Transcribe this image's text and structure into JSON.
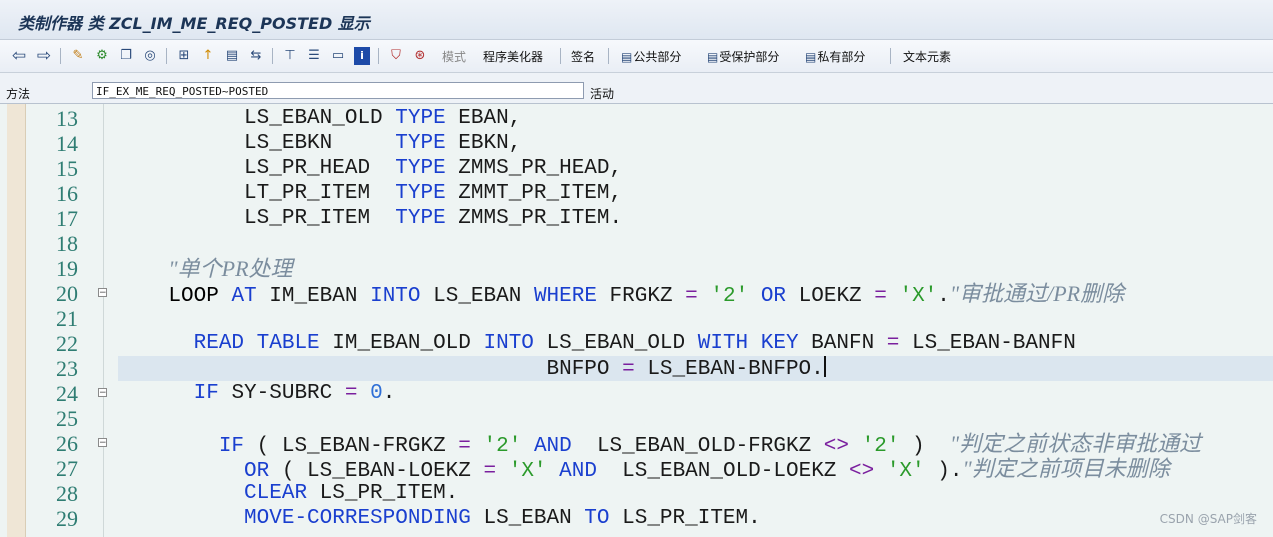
{
  "window": {
    "title": "类制作器 类 ZCL_IM_ME_REQ_POSTED 显示"
  },
  "toolbar": {
    "icons": [
      "back-arrow-icon",
      "forward-arrow-icon",
      "edit-pencil-icon",
      "display-change-icon",
      "object-list-icon",
      "where-used-icon",
      "hierarchy-icon",
      "breakpoint-icon",
      "properties-icon",
      "navigate-icon",
      "tree-icon",
      "stack-icon",
      "window-icon",
      "info-icon",
      "pattern-icon",
      "check-icon"
    ],
    "mode": "模式",
    "pretty_printer": "程序美化器",
    "signature": "签名",
    "public_section": "公共部分",
    "protected_section": "受保护部分",
    "private_section": "私有部分",
    "text_elements": "文本元素"
  },
  "method": {
    "label": "方法",
    "value": "IF_EX_ME_REQ_POSTED~POSTED",
    "status": "活动"
  },
  "editor": {
    "lines": [
      {
        "n": "13",
        "fold": false,
        "indent": "          ",
        "parts": [
          [
            "id",
            "LS_EBAN_OLD "
          ],
          [
            "kw",
            "TYPE"
          ],
          [
            "id",
            " EBAN,"
          ]
        ]
      },
      {
        "n": "14",
        "fold": false,
        "indent": "          ",
        "parts": [
          [
            "id",
            "LS_EBKN     "
          ],
          [
            "kw",
            "TYPE"
          ],
          [
            "id",
            " EBKN,"
          ]
        ]
      },
      {
        "n": "15",
        "fold": false,
        "indent": "          ",
        "parts": [
          [
            "id",
            "LS_PR_HEAD  "
          ],
          [
            "kw",
            "TYPE"
          ],
          [
            "id",
            " ZMMS_PR_HEAD,"
          ]
        ]
      },
      {
        "n": "16",
        "fold": false,
        "indent": "          ",
        "parts": [
          [
            "id",
            "LT_PR_ITEM  "
          ],
          [
            "kw",
            "TYPE"
          ],
          [
            "id",
            " ZMMT_PR_ITEM,"
          ]
        ]
      },
      {
        "n": "17",
        "fold": false,
        "indent": "          ",
        "parts": [
          [
            "id",
            "LS_PR_ITEM  "
          ],
          [
            "kw",
            "TYPE"
          ],
          [
            "id",
            " ZMMS_PR_ITEM."
          ]
        ]
      },
      {
        "n": "18",
        "fold": false,
        "indent": "",
        "parts": []
      },
      {
        "n": "19",
        "fold": false,
        "indent": "    ",
        "parts": [
          [
            "cm",
            "\"单个PR处理"
          ]
        ]
      },
      {
        "n": "20",
        "fold": true,
        "indent": "    ",
        "parts": [
          [
            "kwb",
            "LOOP"
          ],
          [
            "id",
            " "
          ],
          [
            "kw",
            "AT"
          ],
          [
            "id",
            " IM_EBAN "
          ],
          [
            "kw",
            "INTO"
          ],
          [
            "id",
            " LS_EBAN "
          ],
          [
            "kw",
            "WHERE"
          ],
          [
            "id",
            " FRGKZ "
          ],
          [
            "op",
            "="
          ],
          [
            "id",
            " "
          ],
          [
            "str",
            "'2'"
          ],
          [
            "id",
            " "
          ],
          [
            "kw",
            "OR"
          ],
          [
            "id",
            " LOEKZ "
          ],
          [
            "op",
            "="
          ],
          [
            "id",
            " "
          ],
          [
            "str",
            "'X'"
          ],
          [
            "id",
            "."
          ],
          [
            "cm",
            "\"审批通过/PR删除"
          ]
        ]
      },
      {
        "n": "21",
        "fold": false,
        "indent": "",
        "parts": []
      },
      {
        "n": "22",
        "fold": false,
        "indent": "      ",
        "parts": [
          [
            "kw",
            "READ TABLE"
          ],
          [
            "id",
            " IM_EBAN_OLD "
          ],
          [
            "kw",
            "INTO"
          ],
          [
            "id",
            " LS_EBAN_OLD "
          ],
          [
            "kw",
            "WITH KEY"
          ],
          [
            "id",
            " BANFN "
          ],
          [
            "op",
            "="
          ],
          [
            "id",
            " LS_EBAN-BANFN"
          ]
        ]
      },
      {
        "n": "23",
        "fold": false,
        "indent": "                                  ",
        "parts": [
          [
            "id",
            "BNFPO "
          ],
          [
            "op",
            "="
          ],
          [
            "id",
            " LS_EBAN-BNFPO."
          ],
          [
            "caret",
            ""
          ]
        ]
      },
      {
        "n": "24",
        "fold": true,
        "indent": "      ",
        "parts": [
          [
            "kw",
            "IF"
          ],
          [
            "id",
            " SY-SUBRC "
          ],
          [
            "op",
            "="
          ],
          [
            "id",
            " "
          ],
          [
            "num",
            "0"
          ],
          [
            "id",
            "."
          ]
        ]
      },
      {
        "n": "25",
        "fold": false,
        "indent": "",
        "parts": []
      },
      {
        "n": "26",
        "fold": true,
        "indent": "        ",
        "parts": [
          [
            "kw",
            "IF"
          ],
          [
            "id",
            " ( LS_EBAN-FRGKZ "
          ],
          [
            "op",
            "="
          ],
          [
            "id",
            " "
          ],
          [
            "str",
            "'2'"
          ],
          [
            "id",
            " "
          ],
          [
            "kw",
            "AND"
          ],
          [
            "id",
            "  LS_EBAN_OLD-FRGKZ "
          ],
          [
            "op",
            "<>"
          ],
          [
            "id",
            " "
          ],
          [
            "str",
            "'2'"
          ],
          [
            "id",
            " )  "
          ],
          [
            "cm",
            "\"判定之前状态非审批通过"
          ]
        ]
      },
      {
        "n": "27",
        "fold": false,
        "indent": "          ",
        "parts": [
          [
            "kw",
            "OR"
          ],
          [
            "id",
            " ( LS_EBAN-LOEKZ "
          ],
          [
            "op",
            "="
          ],
          [
            "id",
            " "
          ],
          [
            "str",
            "'X'"
          ],
          [
            "id",
            " "
          ],
          [
            "kw",
            "AND"
          ],
          [
            "id",
            "  LS_EBAN_OLD-LOEKZ "
          ],
          [
            "op",
            "<>"
          ],
          [
            "id",
            " "
          ],
          [
            "str",
            "'X'"
          ],
          [
            "id",
            " )."
          ],
          [
            "cm",
            "\"判定之前项目未删除"
          ]
        ]
      },
      {
        "n": "28",
        "fold": false,
        "indent": "          ",
        "parts": [
          [
            "kw",
            "CLEAR"
          ],
          [
            "id",
            " LS_PR_ITEM."
          ]
        ]
      },
      {
        "n": "29",
        "fold": false,
        "indent": "          ",
        "parts": [
          [
            "kw",
            "MOVE-CORRESPONDING"
          ],
          [
            "id",
            " LS_EBAN "
          ],
          [
            "kw",
            "TO"
          ],
          [
            "id",
            " LS_PR_ITEM."
          ]
        ]
      }
    ]
  },
  "watermark": "CSDN @SAP剑客"
}
